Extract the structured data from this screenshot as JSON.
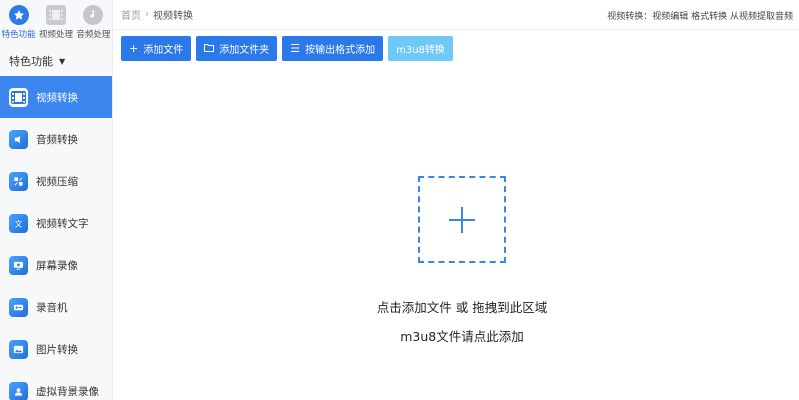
{
  "sidebar": {
    "tabs": [
      {
        "label": "特色功能",
        "icon": "star-icon",
        "active": true
      },
      {
        "label": "视频处理",
        "icon": "film-icon",
        "active": false
      },
      {
        "label": "音频处理",
        "icon": "audio-icon",
        "active": false
      }
    ],
    "section_title": "特色功能",
    "items": [
      {
        "label": "视频转换",
        "icon": "video-convert-icon",
        "active": true
      },
      {
        "label": "音频转换",
        "icon": "audio-convert-icon"
      },
      {
        "label": "视频压缩",
        "icon": "video-compress-icon"
      },
      {
        "label": "视频转文字",
        "icon": "video-to-text-icon"
      },
      {
        "label": "屏幕录像",
        "icon": "screen-record-icon"
      },
      {
        "label": "录音机",
        "icon": "recorder-icon"
      },
      {
        "label": "图片转换",
        "icon": "image-convert-icon"
      },
      {
        "label": "虚拟背景录像",
        "icon": "virtual-background-icon"
      }
    ]
  },
  "header": {
    "breadcrumb": [
      "首页",
      "视频转换"
    ],
    "right_text": "视频转换：视频编辑 格式转换 从视频提取音频"
  },
  "toolbar": {
    "add_file": "添加文件",
    "add_folder": "添加文件夹",
    "add_by_format": "按输出格式添加",
    "m3u8": "m3u8转换"
  },
  "dropzone": {
    "line1": "点击添加文件 或 拖拽到此区域",
    "line2": "m3u8文件请点此添加"
  },
  "colors": {
    "accent": "#2b78e8",
    "active_nav": "#3b86ef",
    "light_button": "#6fc8f6",
    "dashed_border": "#3a86e6"
  }
}
